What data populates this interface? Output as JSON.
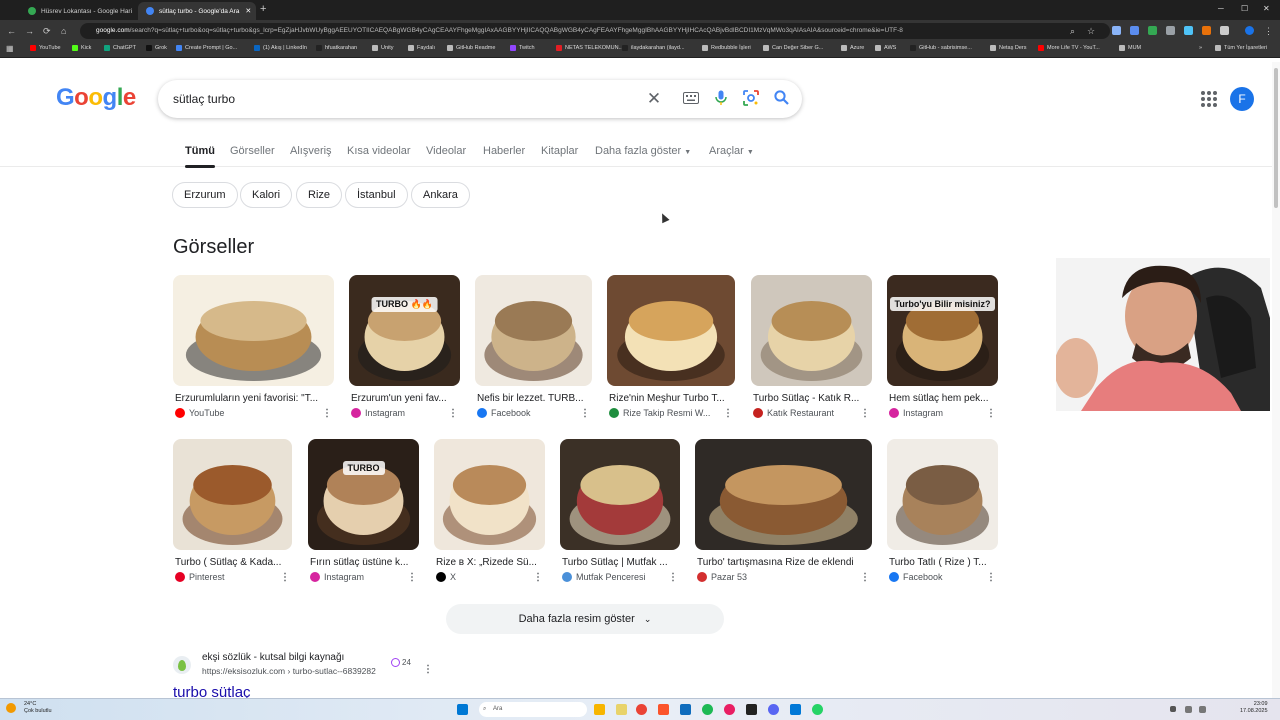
{
  "browser": {
    "tabs": [
      {
        "title": "Hüsrev Lokantası - Google Hari",
        "active": false,
        "favicon_color": "#34a853"
      },
      {
        "title": "sütlaç turbo - Google'da Ara",
        "active": true,
        "favicon_color": "#4285f4"
      }
    ],
    "url_prefix": "google.com",
    "url_rest": "/search?q=sütlaç+turbo&oq=sütlaç+turbo&gs_lcrp=EgZjaHJvbWUyBggAEEUYOTIICAEQABgWGB4yCAgCEAAYFhgeMggIAxAAGBYYHjIICAQQABgWGB4yCAgFEAAYFhgeMggIBhAAGBYYHjIHCAcQABjvBdIBCDI1MzVqMWo3qAIAsAIA&sourceid=chrome&ie=UTF-8",
    "bookmarks": [
      {
        "label": "YouTube",
        "color": "#ff0000"
      },
      {
        "label": "Kick",
        "color": "#53fc18"
      },
      {
        "label": "ChatGPT",
        "color": "#10a37f"
      },
      {
        "label": "Grok",
        "color": "#111111"
      },
      {
        "label": "Create Prompt | Go...",
        "color": "#4285f4"
      },
      {
        "label": "(1) Akış | LinkedIn",
        "color": "#0a66c2"
      },
      {
        "label": "hfuatkarahan",
        "color": "#222222"
      },
      {
        "label": "Unity",
        "color": "#bbbbbb"
      },
      {
        "label": "Faydalı",
        "color": "#bbbbbb"
      },
      {
        "label": "GitHub Readme",
        "color": "#bbbbbb"
      },
      {
        "label": "Twitch",
        "color": "#9146ff"
      },
      {
        "label": "NETAS TELEKOMUN...",
        "color": "#e31e24"
      },
      {
        "label": "ilaydakarahan (ilayd...",
        "color": "#222222"
      },
      {
        "label": "Redbubble İşleri",
        "color": "#bbbbbb"
      },
      {
        "label": "Can Değer Siber G...",
        "color": "#bbbbbb"
      },
      {
        "label": "Azure",
        "color": "#bbbbbb"
      },
      {
        "label": "AWS",
        "color": "#bbbbbb"
      },
      {
        "label": "GitHub - sabrisimse...",
        "color": "#222222"
      },
      {
        "label": "Netaş Ders",
        "color": "#bbbbbb"
      },
      {
        "label": "More Life TV - YouT...",
        "color": "#ff0000"
      },
      {
        "label": "MUM",
        "color": "#bbbbbb"
      }
    ],
    "all_bookmarks_label": "Tüm Yer İşaretleri"
  },
  "google": {
    "logo_letters": [
      {
        "ch": "G",
        "color": "#4285f4"
      },
      {
        "ch": "o",
        "color": "#ea4335"
      },
      {
        "ch": "o",
        "color": "#fbbc05"
      },
      {
        "ch": "g",
        "color": "#4285f4"
      },
      {
        "ch": "l",
        "color": "#34a853"
      },
      {
        "ch": "e",
        "color": "#ea4335"
      }
    ],
    "query": "sütlaç turbo",
    "avatar_letter": "F",
    "nav_tabs": [
      "Tümü",
      "Görseller",
      "Alışveriş",
      "Kısa videolar",
      "Videolar",
      "Haberler",
      "Kitaplar",
      "Daha fazla göster"
    ],
    "tools_label": "Araçlar",
    "chips": [
      "Erzurum",
      "Kalori",
      "Rize",
      "İstanbul",
      "Ankara"
    ],
    "images_section_title": "Görseller",
    "images_row1": [
      {
        "caption": "Erzurumluların yeni favorisi: \"T...",
        "source": "YouTube",
        "source_icon": "youtube-icon",
        "source_color": "#ff0000"
      },
      {
        "caption": "Erzurum'un yeni fav...",
        "source": "Instagram",
        "source_icon": "instagram-icon",
        "source_color": "#d6249f",
        "overlay": "TURBO 🔥🔥"
      },
      {
        "caption": "Nefis bir lezzet. TURB...",
        "source": "Facebook",
        "source_icon": "facebook-icon",
        "source_color": "#1877f2"
      },
      {
        "caption": "Rize'nin Meşhur Turbo T...",
        "source": "Rize Takip Resmi W...",
        "source_icon": "globe-icon",
        "source_color": "#1e8e3e"
      },
      {
        "caption": "Turbo Sütlaç - Katık R...",
        "source": "Katık Restaurant",
        "source_icon": "restaurant-icon",
        "source_color": "#c5221f"
      },
      {
        "caption": "Hem sütlaç hem pek...",
        "source": "Instagram",
        "source_icon": "instagram-icon",
        "source_color": "#d6249f",
        "overlay": "Turbo'yu Bilir misiniz?"
      }
    ],
    "images_row2": [
      {
        "caption": "Turbo ( Sütlaç & Kada...",
        "source": "Pinterest",
        "source_icon": "pinterest-icon",
        "source_color": "#e60023"
      },
      {
        "caption": "Fırın sütlaç üstüne k...",
        "source": "Instagram",
        "source_icon": "instagram-icon",
        "source_color": "#d6249f",
        "overlay": "TURBO"
      },
      {
        "caption": "Rize в X: „Rizede Sü...",
        "source": "X",
        "source_icon": "x-icon",
        "source_color": "#000000"
      },
      {
        "caption": "Turbo Sütlaç | Mutfak ...",
        "source": "Mutfak Penceresi",
        "source_icon": "globe-icon",
        "source_color": "#4a90d9"
      },
      {
        "caption": "Turbo' tartışmasına Rize de eklendi",
        "source": "Pazar 53",
        "source_icon": "news-icon",
        "source_color": "#d32f2f"
      },
      {
        "caption": "Turbo Tatlı ( Rize ) T...",
        "source": "Facebook",
        "source_icon": "facebook-icon",
        "source_color": "#1877f2"
      }
    ],
    "more_images_label": "Daha fazla resim göster",
    "result": {
      "site": "ekşi sözlük - kutsal bilgi kaynağı",
      "url": "https://eksisozluk.com › turbo-sutlac--6839282",
      "badge_count": "24",
      "title": "turbo sütlaç"
    }
  },
  "taskbar": {
    "weather_temp": "24°C",
    "weather_desc": "Çok bulutlu",
    "search_placeholder": "Ara",
    "time": "23:09",
    "date": "17.08.2025"
  }
}
